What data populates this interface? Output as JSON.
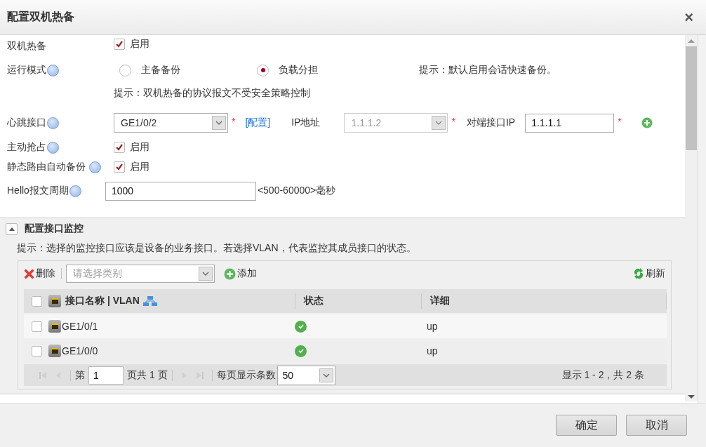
{
  "window": {
    "title": "配置双机热备",
    "close": "×"
  },
  "hot_standby": {
    "label": "双机热备",
    "checked": true,
    "option": "启用"
  },
  "run_mode": {
    "label": "运行模式",
    "options": [
      {
        "label": "主备备份",
        "selected": false
      },
      {
        "label": "负载分担",
        "selected": true
      }
    ],
    "note": "提示：默认启用会话快速备份。"
  },
  "protocol_hint": "提示：双机热备的协议报文不受安全策略控制",
  "heartbeat": {
    "label": "心跳接口",
    "value": "GE1/0/2",
    "mark": "*",
    "config_link": "[配置]",
    "ip_label": "IP地址",
    "ip_value": "1.1.1.2",
    "ip_disabled": true,
    "ip_mark": "*",
    "peer_label": "对端接口IP",
    "peer_value": "1.1.1.1",
    "peer_mark": "*"
  },
  "preempt": {
    "label": "主动抢占",
    "checked": true,
    "option": "启用"
  },
  "static_route_backup": {
    "label": "静态路由自动备份",
    "checked": true,
    "option": "启用"
  },
  "hello": {
    "label": "Hello报文周期",
    "value": "1000",
    "range": "<500-60000>毫秒"
  },
  "monitor": {
    "title": "配置接口监控",
    "expanded": true,
    "hint": "提示：选择的监控接口应该是设备的业务接口。若选择VLAN，代表监控其成员接口的状态。",
    "toolbar": {
      "delete": "删除",
      "category_placeholder": "请选择类别",
      "add": "添加",
      "refresh": "刷新"
    },
    "all_checked": false,
    "columns": [
      "接口名称 | VLAN",
      "状态",
      "详细"
    ],
    "rows": [
      {
        "checked": false,
        "name": "GE1/0/1",
        "status_ok": true,
        "detail": "up"
      },
      {
        "checked": false,
        "name": "GE1/0/0",
        "status_ok": true,
        "detail": "up"
      }
    ],
    "pager": {
      "page_prefix": "第",
      "page": "1",
      "page_suffix": "页共 1 页",
      "per_page_label": "每页显示条数",
      "per_page": "50",
      "summary": "显示 1 - 2，共 2 条"
    }
  },
  "buttons": [
    "确定",
    "取消"
  ]
}
